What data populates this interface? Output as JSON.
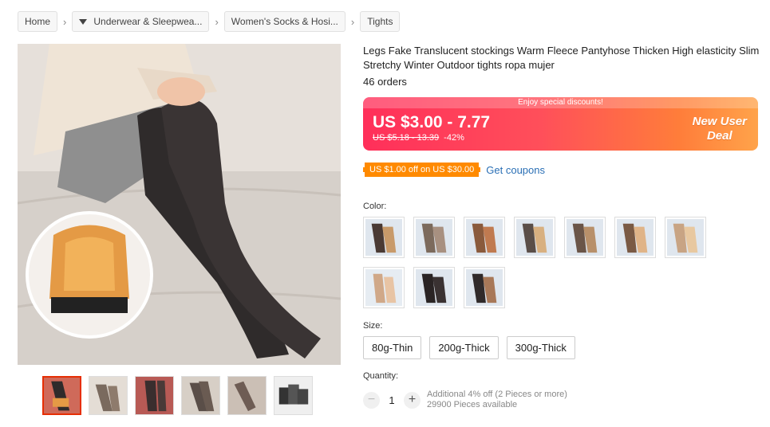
{
  "breadcrumb": {
    "items": [
      {
        "label": "Home"
      },
      {
        "label": "Underwear & Sleepwea..."
      },
      {
        "label": "Women's Socks & Hosi..."
      },
      {
        "label": "Tights"
      }
    ],
    "separator": "›"
  },
  "product": {
    "title": "Legs Fake Translucent stockings Warm Fleece Pantyhose Thicken High elasticity Slim Stretchy Winter Outdoor tights ropa mujer",
    "orders": "46 orders"
  },
  "price": {
    "banner": "Enjoy special discounts!",
    "current": "US $3.00 - 7.77",
    "original": "US $5.18 - 13.39",
    "discount": "-42%",
    "badge_line1": "New User",
    "badge_line2": "Deal"
  },
  "coupon": {
    "tag": "US $1.00 off on US $30.00",
    "link": "Get coupons"
  },
  "color": {
    "label": "Color:",
    "swatch_count": 10
  },
  "size": {
    "label": "Size:",
    "options": [
      "80g-Thin",
      "200g-Thick",
      "300g-Thick"
    ]
  },
  "quantity": {
    "label": "Quantity:",
    "minus": "−",
    "value": "1",
    "plus": "+",
    "note1": "Additional 4% off (2 Pieces or more)",
    "note2": "29900 Pieces available"
  },
  "colors": {
    "price_gradient_start": "#ff2f5a",
    "price_gradient_end": "#ffa34a",
    "coupon": "#ff8a00",
    "link": "#2a6fb5",
    "active_thumb": "#e62e04"
  }
}
